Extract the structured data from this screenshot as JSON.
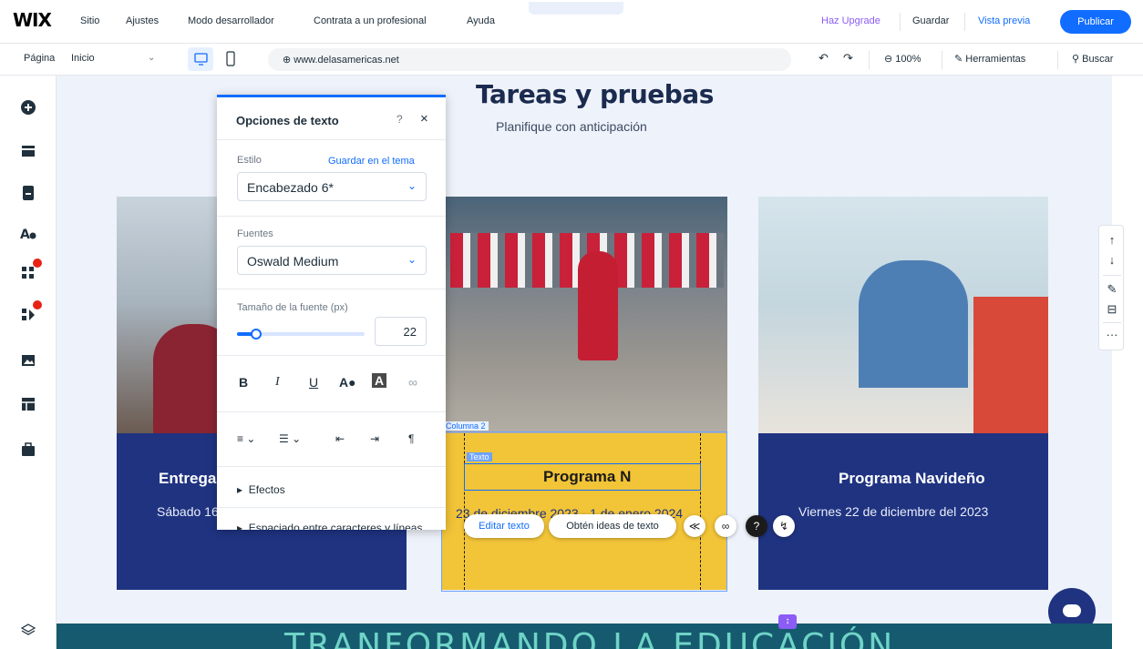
{
  "topbar": {
    "logo": "WIX",
    "menu": [
      "Sitio",
      "Ajustes",
      "Modo desarrollador",
      "Contrata a un profesional",
      "Ayuda"
    ],
    "upgrade": "Haz Upgrade",
    "save": "Guardar",
    "preview": "Vista previa",
    "publish": "Publicar"
  },
  "secbar": {
    "page_label": "Página",
    "page_value": "Inicio",
    "url": "www.delasamericas.net",
    "zoom": "100%",
    "tools": "Herramientas",
    "search": "Buscar"
  },
  "page": {
    "title": "Tareas y pruebas",
    "subtitle": "Planifique con anticipación",
    "cards": [
      {
        "title": "Entrega d",
        "subtitle": "Sábado 16"
      },
      {
        "title": "Programa N",
        "subtitle": "23 de diciembre 2023 - 1 de enero 2024"
      },
      {
        "title": "Programa Navideño",
        "subtitle": "Viernes 22 de diciembre del 2023"
      }
    ],
    "bottom_text": "TRANFORMANDO LA EDUCACIÓN"
  },
  "panel": {
    "title": "Opciones de texto",
    "help": "?",
    "close": "×",
    "style_label": "Estilo",
    "save_theme": "Guardar en el tema",
    "style_value": "Encabezado 6*",
    "fonts_label": "Fuentes",
    "font_value": "Oswald Medium",
    "size_label": "Tamaño de la fuente (px)",
    "size_value": "22",
    "size_fraction": 0.15,
    "effects": "Efectos",
    "spacing": "Espaciado entre caracteres y líneas"
  },
  "selection": {
    "column_tag": "Columna 2",
    "text_tag": "Texto",
    "edit_text": "Editar texto",
    "ideas": "Obtén ideas de texto"
  },
  "colors": {
    "accent": "#116dff",
    "navy": "#1f3381",
    "gold": "#f2c438",
    "badge": "#e62214"
  }
}
